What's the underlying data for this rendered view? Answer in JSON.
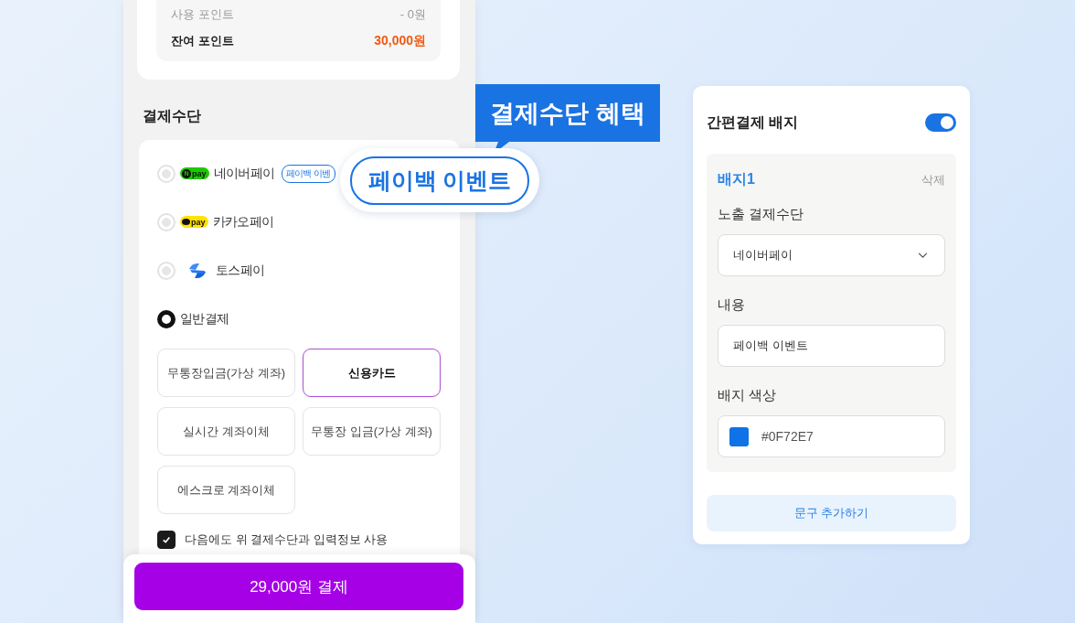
{
  "points": [
    {
      "label": "사용 포인트",
      "value": "- 0원",
      "kind": "used"
    },
    {
      "label": "잔여 포인트",
      "value": "30,000원",
      "kind": "balance"
    }
  ],
  "payment": {
    "title": "결제수단",
    "options": [
      {
        "kind": "naver",
        "logo_mark": "N",
        "logo_text": "pay",
        "label": "네이버페이",
        "badge": "페이백 이벤",
        "selected": false
      },
      {
        "kind": "kakao",
        "logo_text": "pay",
        "label": "카카오페이",
        "selected": false
      },
      {
        "kind": "toss",
        "label": "토스페이",
        "selected": false
      },
      {
        "kind": "plain",
        "label": "일반결제",
        "selected": true
      }
    ],
    "methods": [
      {
        "label": "무통장입금(가상 계좌)",
        "selected": false
      },
      {
        "label": "신용카드",
        "selected": true
      },
      {
        "label": "실시간 계좌이체",
        "selected": false
      },
      {
        "label": "무통장 입금(가상 계좌)",
        "selected": false
      },
      {
        "label": "에스크로 계좌이체",
        "selected": false
      }
    ],
    "remember": {
      "label": "다음에도 위 결제수단과 입력정보 사용",
      "checked": true
    },
    "pay_button": "29,000원 결제"
  },
  "callout": {
    "title": "결제수단 혜택",
    "zoom_badge": "페이백 이벤트"
  },
  "badge_panel": {
    "title": "간편결제 배지",
    "enabled": true,
    "badge_name": "배지1",
    "delete": "삭제",
    "method_label": "노출 결제수단",
    "method_value": "네이버페이",
    "content_label": "내용",
    "content_value": "페이백 이벤트",
    "color_label": "배지 색상",
    "color_value": "#0F72E7",
    "add_button": "문구 추가하기"
  }
}
